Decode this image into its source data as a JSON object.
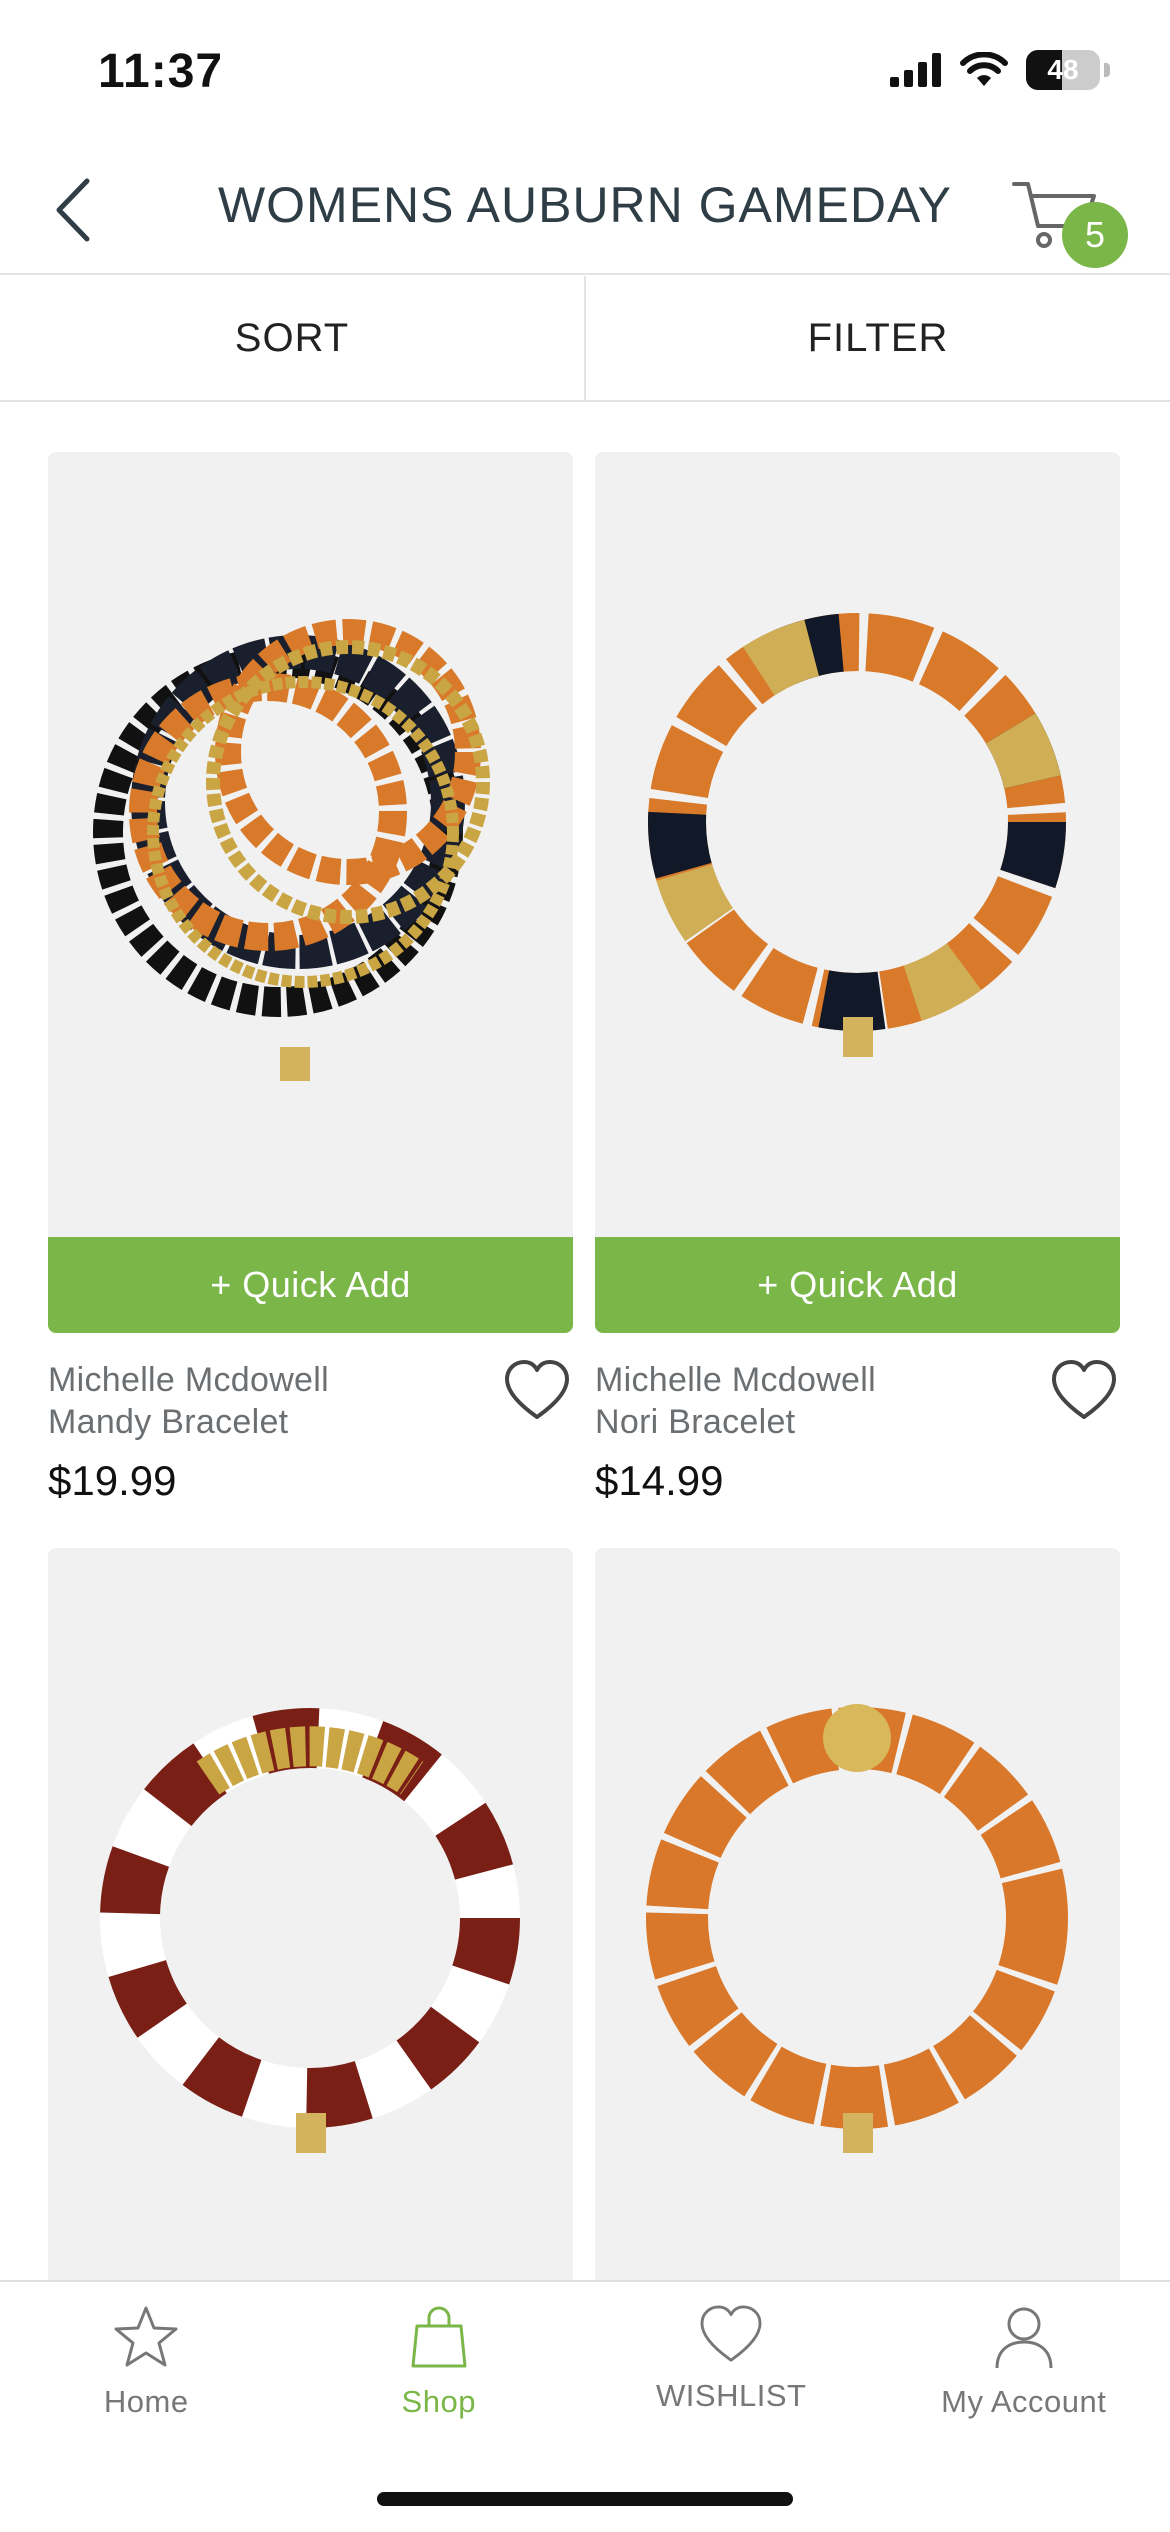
{
  "status_bar": {
    "time": "11:37",
    "battery_level": "48",
    "icons": [
      "cellular-signal-icon",
      "wifi-icon",
      "battery-icon"
    ]
  },
  "header": {
    "title": "WOMENS AUBURN GAMEDAY",
    "back_icon": "chevron-left-icon",
    "cart_icon": "cart-icon",
    "cart_count": "5"
  },
  "toolbar": {
    "sort_label": "SORT",
    "filter_label": "FILTER"
  },
  "products": [
    {
      "brand": "Michelle Mcdowell",
      "name": "Mandy Bracelet",
      "price": "$19.99",
      "quick_add": "+ Quick Add",
      "wishlist_icon": "heart-icon"
    },
    {
      "brand": "Michelle Mcdowell",
      "name": "Nori Bracelet",
      "price": "$14.99",
      "quick_add": "+ Quick Add",
      "wishlist_icon": "heart-icon"
    },
    {
      "image": "maroon-white-bracelet"
    },
    {
      "image": "orange-bracelet"
    }
  ],
  "tabbar": {
    "items": [
      {
        "label": "Home",
        "icon": "star-icon",
        "active": false
      },
      {
        "label": "Shop",
        "icon": "shopping-bag-icon",
        "active": true
      },
      {
        "label": "WISHLIST",
        "icon": "heart-icon",
        "active": false
      },
      {
        "label": "My Account",
        "icon": "user-icon",
        "active": false
      }
    ]
  },
  "colors": {
    "accent": "#7ab648",
    "title_text": "#2f3e46",
    "muted_text": "#6b6f72"
  }
}
